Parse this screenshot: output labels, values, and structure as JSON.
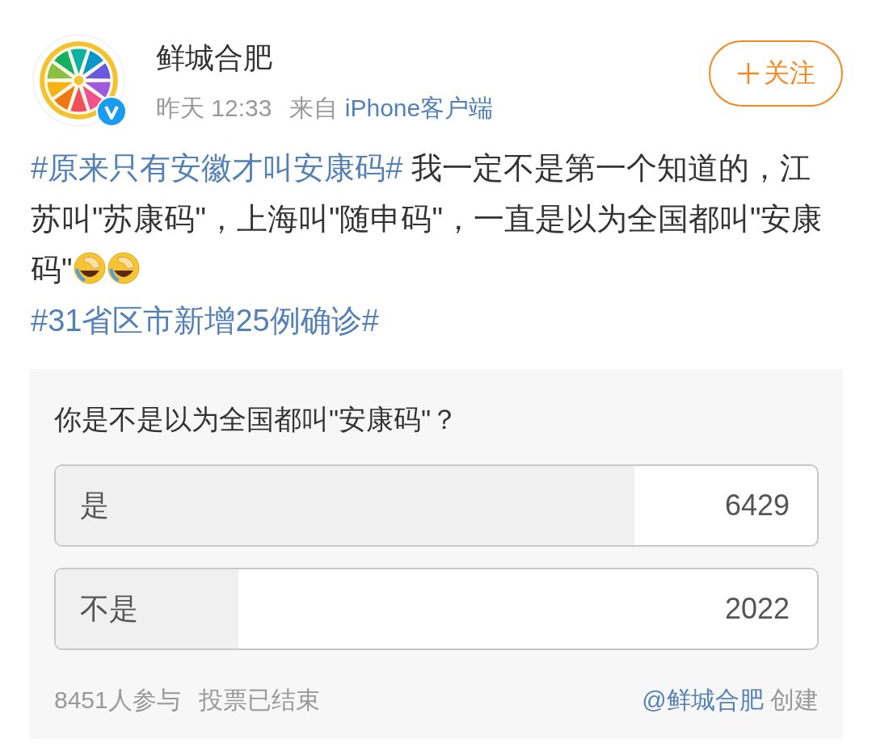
{
  "author": {
    "name": "鲜城合肥",
    "verified": true
  },
  "meta": {
    "time": "昨天 12:33",
    "source_prefix": "来自",
    "source": "iPhone客户端"
  },
  "follow_button": {
    "label": "关注"
  },
  "post": {
    "segments": [
      {
        "kind": "topic",
        "text": "#原来只有安徽才叫安康码#"
      },
      {
        "kind": "text",
        "text": " 我一定不是第一个知道的，江苏叫\"苏康码\"，上海叫\"随申码\"，一直是以为全国都叫\"安康码\""
      },
      {
        "kind": "emoji"
      },
      {
        "kind": "emoji"
      },
      {
        "kind": "break"
      },
      {
        "kind": "topic",
        "text": "#31省区市新增25例确诊#"
      }
    ]
  },
  "poll": {
    "question": "你是不是以为全国都叫\"安康码\"？",
    "options": [
      {
        "label": "是",
        "count": "6429",
        "level": 0.76
      },
      {
        "label": "不是",
        "count": "2022",
        "level": 0.24
      }
    ],
    "participants": "8451人参与",
    "status": "投票已结束",
    "creator": "@鲜城合肥",
    "creator_suffix": "创建"
  }
}
